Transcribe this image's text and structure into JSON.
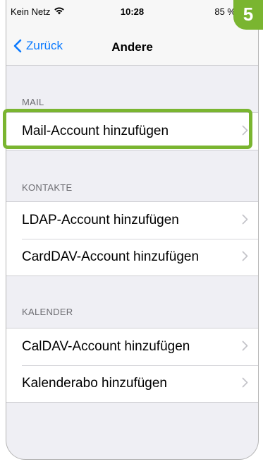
{
  "status_bar": {
    "carrier": "Kein Netz",
    "time": "10:28",
    "battery": "85 %"
  },
  "nav": {
    "back_label": "Zurück",
    "title": "Andere"
  },
  "sections": [
    {
      "header": "MAIL",
      "items": [
        {
          "label": "Mail-Account hinzufügen"
        }
      ]
    },
    {
      "header": "KONTAKTE",
      "items": [
        {
          "label": "LDAP-Account hinzufügen"
        },
        {
          "label": "CardDAV-Account hinzufügen"
        }
      ]
    },
    {
      "header": "KALENDER",
      "items": [
        {
          "label": "CalDAV-Account hinzufügen"
        },
        {
          "label": "Kalenderabo hinzufügen"
        }
      ]
    }
  ],
  "step_badge": "5",
  "colors": {
    "accent": "#7ab530",
    "link": "#0a7aff",
    "background": "#efeff4"
  },
  "icons": {
    "wifi": "wifi-icon",
    "back": "chevron-left-icon",
    "disclosure": "chevron-right-icon"
  }
}
